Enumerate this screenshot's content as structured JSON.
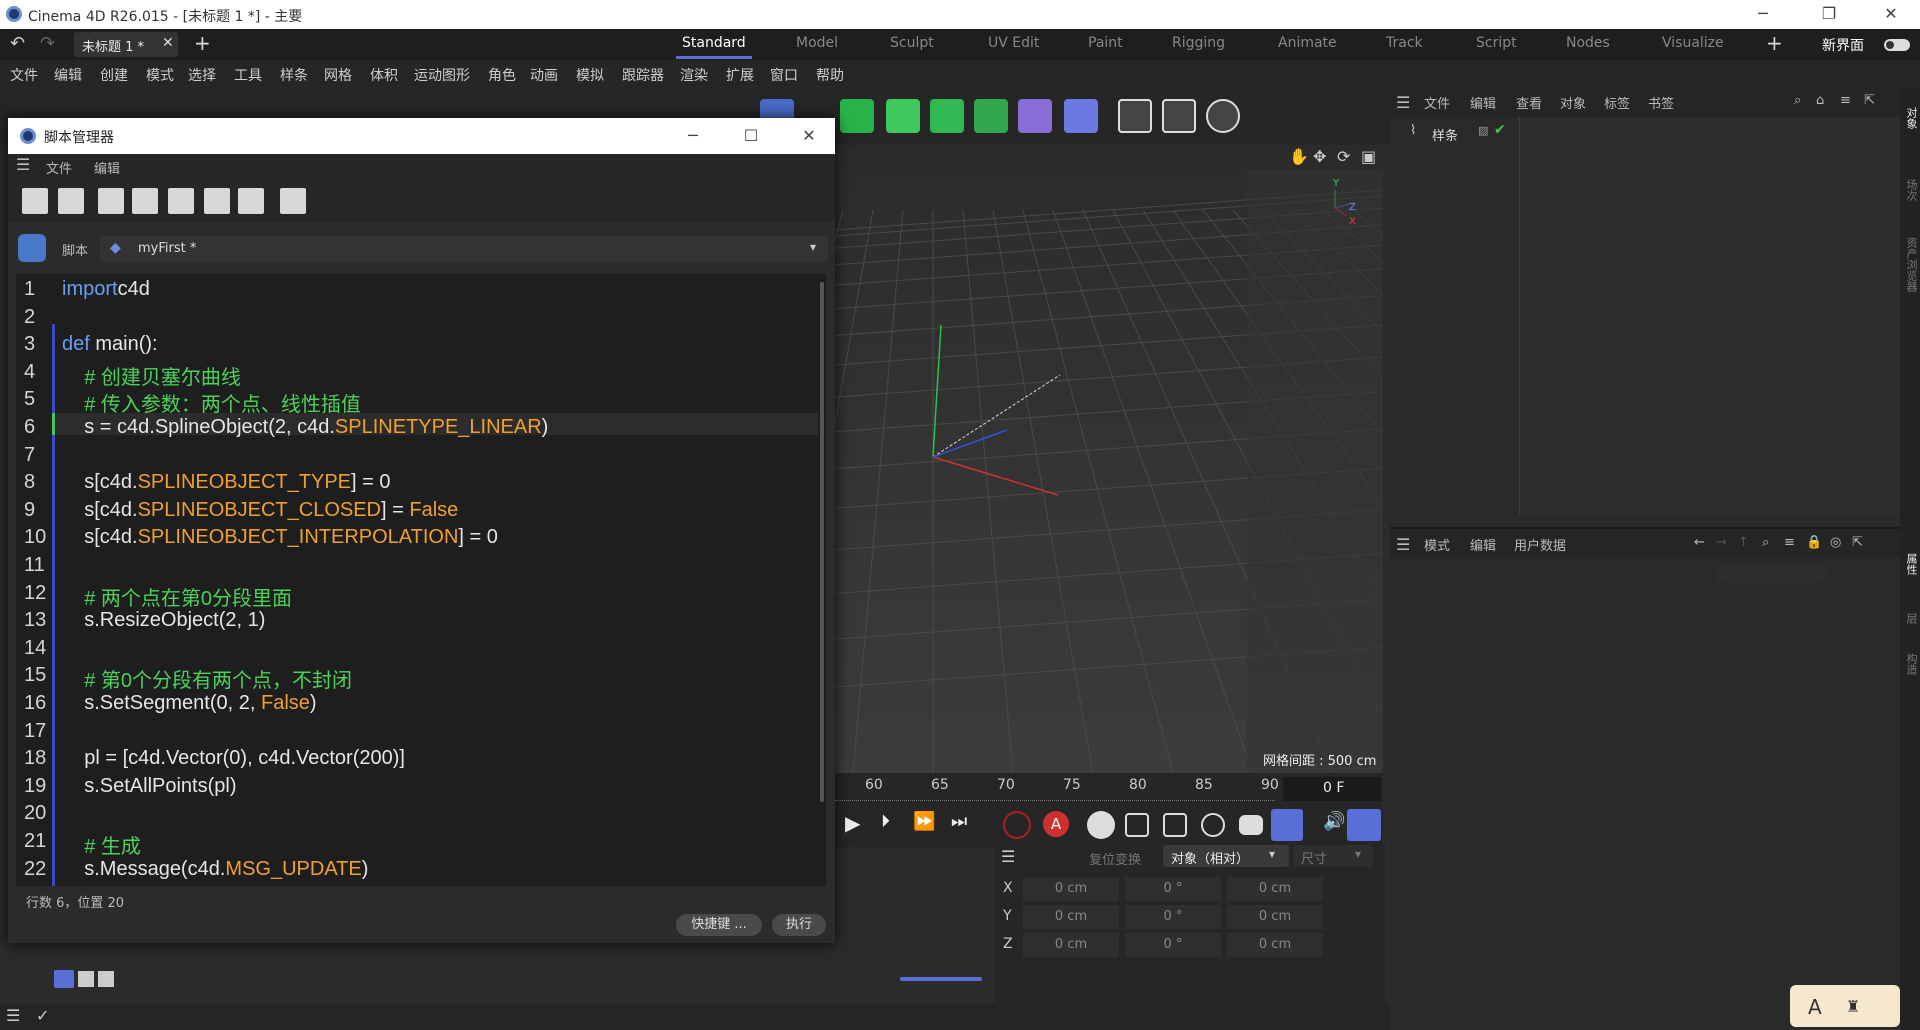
{
  "app": {
    "title": "Cinema 4D R26.015 - [未标题 1 *] - 主要",
    "doc_tab": "未标题 1 *",
    "new_ui_label": "新界面"
  },
  "layouts": [
    "Standard",
    "Model",
    "Sculpt",
    "UV Edit",
    "Paint",
    "Rigging",
    "Animate",
    "Track",
    "Script",
    "Nodes",
    "Visualize"
  ],
  "active_layout": "Standard",
  "menu": [
    "文件",
    "编辑",
    "创建",
    "模式",
    "选择",
    "工具",
    "样条",
    "网格",
    "体积",
    "运动图形",
    "角色",
    "动画",
    "模拟",
    "跟踪器",
    "渲染",
    "扩展",
    "窗口",
    "帮助"
  ],
  "toolbar_icons": [
    "cube-icon",
    "deformer-icon",
    "cloner-icon",
    "mograph-icon",
    "fracture-icon",
    "pen-icon",
    "grid-icon",
    "camera-icon",
    "light-icon"
  ],
  "object_manager": {
    "menu": [
      "文件",
      "编辑",
      "查看",
      "对象",
      "标签",
      "书签"
    ],
    "object_name": "样条"
  },
  "attribute_manager": {
    "menu": [
      "模式",
      "编辑",
      "用户数据"
    ]
  },
  "right_tabs": [
    "对象",
    "场次",
    "资产浏览器",
    "属性",
    "层",
    "构造"
  ],
  "viewport": {
    "grid_spacing_label": "网格间距 : 500 cm",
    "axis_labels": [
      "Y",
      "Z",
      "X"
    ]
  },
  "timeline": {
    "ticks": [
      "60",
      "65",
      "70",
      "75",
      "80",
      "85",
      "90"
    ],
    "current_frame": "0 F"
  },
  "coord_manager": {
    "tabs": [
      "复位变换",
      "对象（相对）",
      "尺寸"
    ],
    "rows": [
      {
        "axis": "X",
        "pos": "0 cm",
        "rot": "0 °",
        "size": "0 cm"
      },
      {
        "axis": "Y",
        "pos": "0 cm",
        "rot": "0 °",
        "size": "0 cm"
      },
      {
        "axis": "Z",
        "pos": "0 cm",
        "rot": "0 °",
        "size": "0 cm"
      }
    ]
  },
  "script_manager": {
    "title": "脚本管理器",
    "menu": [
      "文件",
      "编辑"
    ],
    "script_label": "脚本",
    "script_name": "myFirst *",
    "status": "行数 6，位置 20",
    "shortcut_button": "快捷键 ...",
    "execute_button": "执行",
    "code": [
      {
        "n": "1",
        "parts": [
          [
            "kw",
            "import"
          ],
          [
            "",
            "c4d"
          ]
        ]
      },
      {
        "n": "2",
        "parts": []
      },
      {
        "n": "3",
        "parts": [
          [
            "kw",
            "def"
          ],
          [
            "",
            " main():"
          ]
        ]
      },
      {
        "n": "4",
        "parts": [
          [
            "cm",
            "    # 创建贝塞尔曲线"
          ]
        ]
      },
      {
        "n": "5",
        "parts": [
          [
            "cm",
            "    # 传入参数：两个点、线性插值"
          ]
        ]
      },
      {
        "n": "6",
        "parts": [
          [
            "",
            "    s = c4d.SplineObject(2, c4d."
          ],
          [
            "cs",
            "SPLINETYPE_LINEAR"
          ],
          [
            "",
            ")"
          ]
        ]
      },
      {
        "n": "7",
        "parts": []
      },
      {
        "n": "8",
        "parts": [
          [
            "",
            "    s[c4d."
          ],
          [
            "cs",
            "SPLINEOBJECT_TYPE"
          ],
          [
            "",
            "] = 0"
          ]
        ]
      },
      {
        "n": "9",
        "parts": [
          [
            "",
            "    s[c4d."
          ],
          [
            "cs",
            "SPLINEOBJECT_CLOSED"
          ],
          [
            "",
            "] = "
          ],
          [
            "cs",
            "False"
          ]
        ]
      },
      {
        "n": "10",
        "parts": [
          [
            "",
            "    s[c4d."
          ],
          [
            "cs",
            "SPLINEOBJECT_INTERPOLATION"
          ],
          [
            "",
            "] = 0"
          ]
        ]
      },
      {
        "n": "11",
        "parts": []
      },
      {
        "n": "12",
        "parts": [
          [
            "cm",
            "    # 两个点在第0分段里面"
          ]
        ]
      },
      {
        "n": "13",
        "parts": [
          [
            "",
            "    s.ResizeObject(2, 1)"
          ]
        ]
      },
      {
        "n": "14",
        "parts": []
      },
      {
        "n": "15",
        "parts": [
          [
            "cm",
            "    # 第0个分段有两个点，不封闭"
          ]
        ]
      },
      {
        "n": "16",
        "parts": [
          [
            "",
            "    s.SetSegment(0, 2, "
          ],
          [
            "cs",
            "False"
          ],
          [
            "",
            ")"
          ]
        ]
      },
      {
        "n": "17",
        "parts": []
      },
      {
        "n": "18",
        "parts": [
          [
            "",
            "    pl = [c4d.Vector(0), c4d.Vector(200)]"
          ]
        ]
      },
      {
        "n": "19",
        "parts": [
          [
            "",
            "    s.SetAllPoints(pl)"
          ]
        ]
      },
      {
        "n": "20",
        "parts": []
      },
      {
        "n": "21",
        "parts": [
          [
            "cm",
            "    # 生成"
          ]
        ]
      },
      {
        "n": "22",
        "parts": [
          [
            "",
            "    s.Message(c4d."
          ],
          [
            "cs",
            "MSG_UPDATE"
          ],
          [
            "",
            ")"
          ]
        ]
      }
    ]
  },
  "colors": {
    "accent": "#5a6ed8",
    "keyword": "#6a9ff0",
    "comment": "#4cd15a",
    "constant": "#f0a030"
  }
}
